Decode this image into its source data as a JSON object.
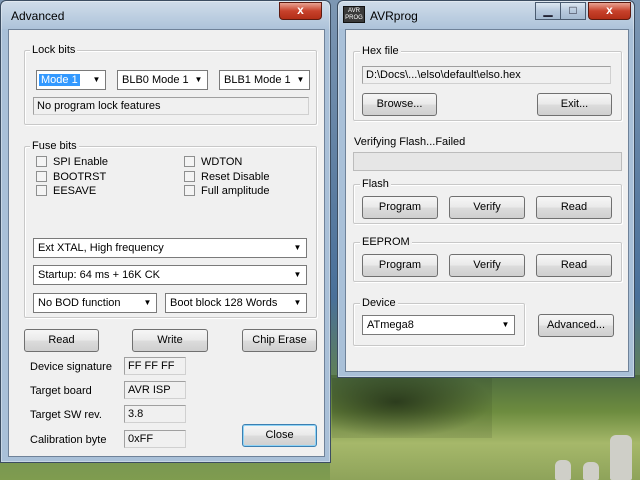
{
  "advanced_window": {
    "title": "Advanced",
    "close_glyph": "x",
    "lock_bits": {
      "label": "Lock bits",
      "mode_select": "Mode 1",
      "blb0_select": "BLB0 Mode 1",
      "blb1_select": "BLB1 Mode 1",
      "status": "No program lock features"
    },
    "fuse_bits": {
      "label": "Fuse bits",
      "checkboxes_left": [
        "SPI Enable",
        "BOOTRST",
        "EESAVE"
      ],
      "checkboxes_right": [
        "WDTON",
        "Reset Disable",
        "Full amplitude"
      ],
      "clock_select": "Ext XTAL, High frequency",
      "startup_select": "Startup: 64 ms + 16K CK",
      "bod_select": "No BOD function",
      "bootblock_select": "Boot block 128 Words"
    },
    "buttons": {
      "read": "Read",
      "write": "Write",
      "chip_erase": "Chip Erase",
      "close": "Close"
    },
    "info": [
      {
        "label": "Device signature",
        "value": "FF FF FF"
      },
      {
        "label": "Target board",
        "value": "AVR ISP"
      },
      {
        "label": "Target SW rev.",
        "value": "3.8"
      },
      {
        "label": "Calibration byte",
        "value": "0xFF"
      }
    ]
  },
  "avrprog_window": {
    "title": "AVRprog",
    "icon_text": "AVR PROG",
    "hex_file": {
      "label": "Hex file",
      "path": "D:\\Docs\\...\\elso\\default\\elso.hex",
      "browse": "Browse...",
      "exit": "Exit..."
    },
    "status": "Verifying Flash...Failed",
    "flash": {
      "label": "Flash",
      "program": "Program",
      "verify": "Verify",
      "read": "Read"
    },
    "eeprom": {
      "label": "EEPROM",
      "program": "Program",
      "verify": "Verify",
      "read": "Read"
    },
    "device": {
      "label": "Device",
      "select": "ATmega8",
      "advanced": "Advanced..."
    }
  },
  "colors": {
    "close_button": "#c7412b",
    "selection": "#3399ff",
    "window_frame": "#a9c0d8"
  }
}
